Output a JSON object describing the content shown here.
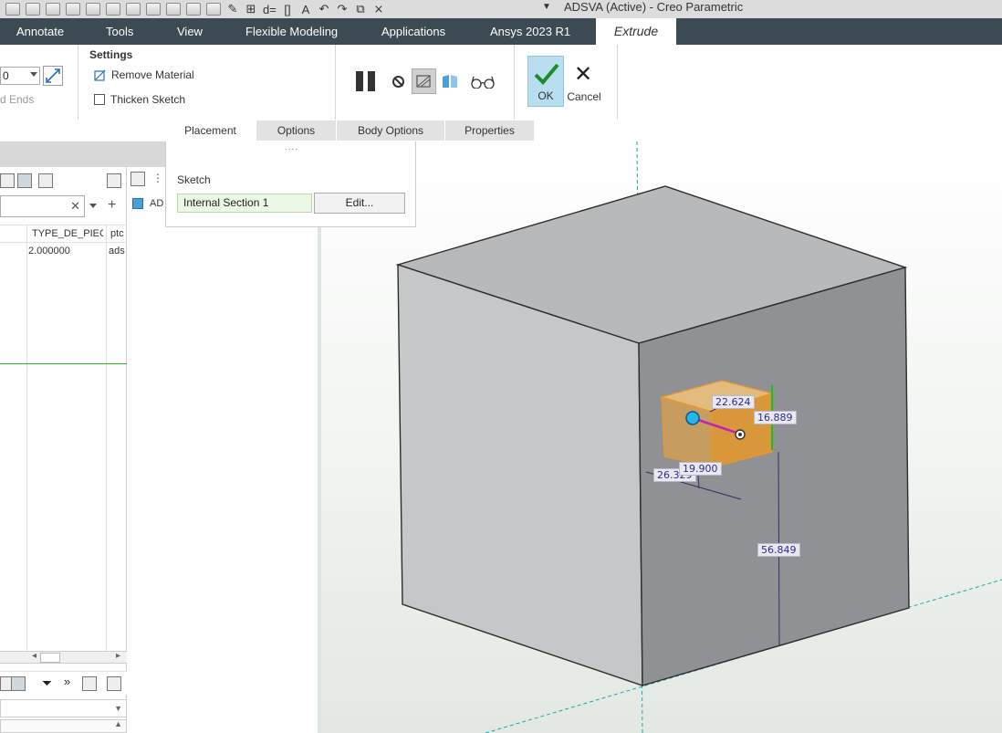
{
  "window": {
    "title": "ADSVA (Active) - Creo Parametric"
  },
  "ribbon_tabs": [
    {
      "label": "Annotate"
    },
    {
      "label": "Tools"
    },
    {
      "label": "View"
    },
    {
      "label": "Flexible Modeling"
    },
    {
      "label": "Applications"
    },
    {
      "label": "Ansys 2023 R1"
    },
    {
      "label": "Extrude",
      "active": true
    }
  ],
  "extrude": {
    "depth_value": "0",
    "ends_label": "d Ends",
    "settings_title": "Settings",
    "remove_material_label": "Remove Material",
    "thicken_sketch_label": "Thicken Sketch",
    "ok_label": "OK",
    "cancel_label": "Cancel",
    "subtabs": [
      "Placement",
      "Options",
      "Body Options",
      "Properties"
    ],
    "active_subtab": "Placement"
  },
  "placement_panel": {
    "grip": "....",
    "sketch_label": "Sketch",
    "sketch_value": "Internal Section 1",
    "edit_button": "Edit..."
  },
  "left_panel": {
    "search_value": "",
    "columns": [
      "TYPE_DE_PIECE",
      "ptc"
    ],
    "row": [
      "2.000000",
      "ads"
    ],
    "tree_item": "AD"
  },
  "viewport": {
    "dimensions": [
      "22.624",
      "16.889",
      "26.329",
      "19.900",
      "56.849"
    ]
  },
  "colors": {
    "tab_bar": "#3c4a54",
    "ok_button": "#b9def0",
    "sketch_field": "#eaf8e4",
    "feature_preview": "#f4a533",
    "cube_front": "#c5c7c9",
    "cube_top": "#b7b9bb",
    "cube_right": "#8f9194"
  }
}
